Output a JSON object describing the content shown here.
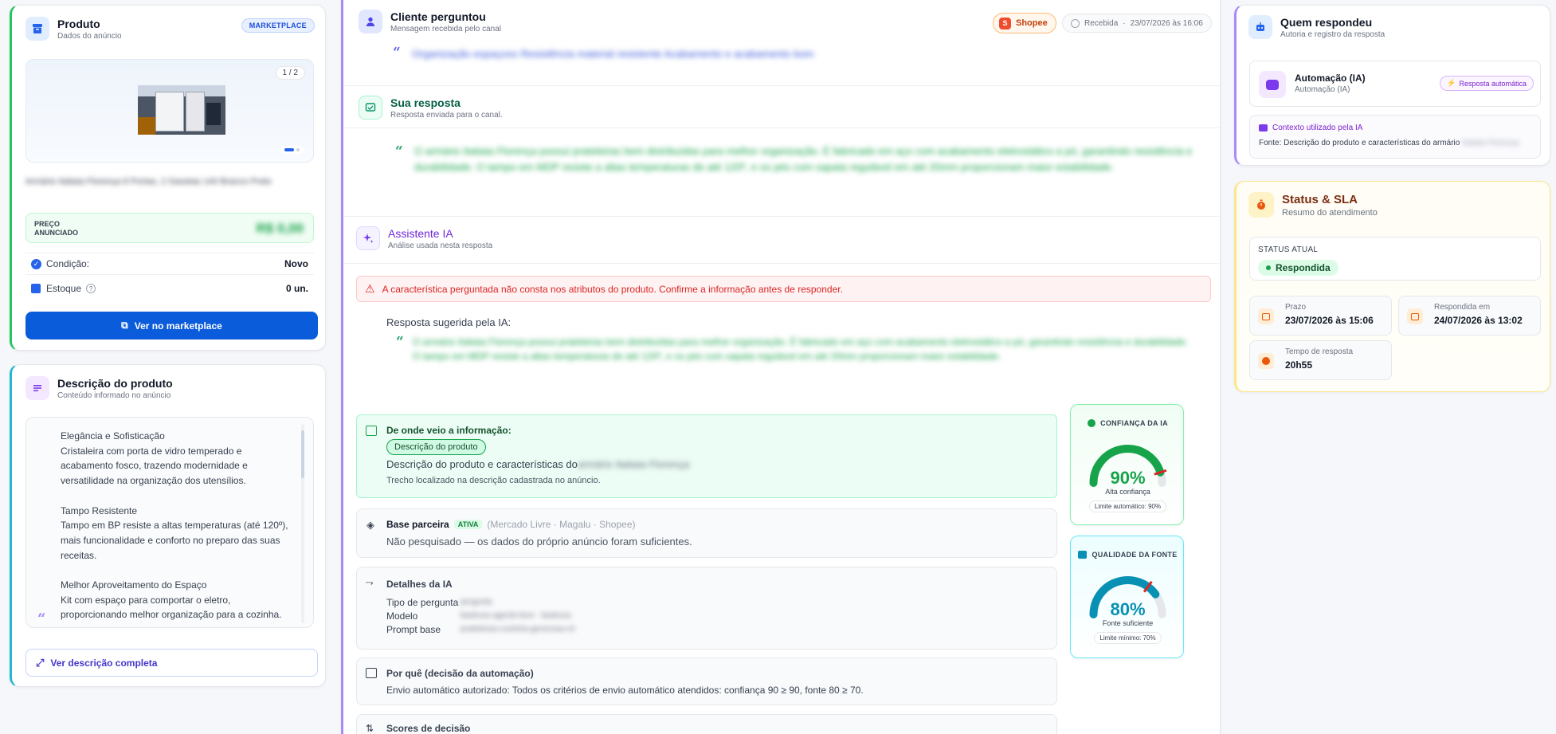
{
  "product": {
    "title": "Produto",
    "subtitle": "Dados do anúncio",
    "badge": "MARKETPLACE",
    "image_counter": "1 / 2",
    "name": "Armário Itatiaia Florença 8 Portas, 2 Gavetas 140 Branco Preto",
    "price_label_1": "PREÇO",
    "price_label_2": "ANUNCIADO",
    "price_value": "R$ 0,00",
    "condition_label": "Condição:",
    "condition_value": "Novo",
    "stock_label": "Estoque",
    "stock_value": "0 un.",
    "view_button": "Ver no marketplace"
  },
  "description": {
    "title": "Descrição do produto",
    "subtitle": "Conteúdo informado no anúncio",
    "lines": [
      "Elegância e Sofisticação",
      "Cristaleira com porta de vidro temperado e",
      "acabamento fosco, trazendo modernidade e",
      "versatilidade na organização dos utensílios.",
      "",
      "Tampo Resistente",
      "Tampo em BP resiste a altas temperaturas (até 120º),",
      "mais funcionalidade e conforto no preparo das suas",
      "receitas.",
      "",
      "Melhor Aproveitamento do Espaço",
      "Kit com espaço para comportar o eletro,",
      "proporcionando melhor organização para a cozinha."
    ],
    "full_link": "Ver descrição completa"
  },
  "question": {
    "title": "Cliente perguntou",
    "subtitle": "Mensagem recebida pelo canal",
    "channel": "Shopee",
    "received_label": "Recebida",
    "received_date": "23/07/2026 às 16:06",
    "text": "Organização espaçoso Resistência material resistente Acabamento e acabamento bom"
  },
  "answer": {
    "title": "Sua resposta",
    "subtitle": "Resposta enviada para o canal.",
    "text": "O armário Itatiaia Florença possui prateleiras bem distribuídas para melhor organização. É fabricado em aço com acabamento eletrostático a pó, garantindo resistência e durabilidade. O tampo em MDP resiste a altas temperaturas de até 120º, e os pés com sapata regulável em até 20mm proporcionam maior estabilidade."
  },
  "assistant": {
    "title": "Assistente IA",
    "subtitle": "Análise usada nesta resposta",
    "warning": "A característica perguntada não consta nos atributos do produto. Confirme a informação antes de responder.",
    "suggested_label": "Resposta sugerida pela IA:",
    "suggested_text": "O armário Itatiaia Florença possui prateleiras bem distribuídas para melhor organização. É fabricado em aço com acabamento eletrostático a pó, garantindo resistência e durabilidade. O tampo em MDP resiste a altas temperaturas de até 120º, e os pés com sapata regulável em até 20mm proporcionam maior estabilidade.",
    "source_title": "De onde veio a informação:",
    "source_chip": "Descrição do produto",
    "source_text": "Descrição do produto e características do",
    "source_text_blur": "armário Itatiaia Florença",
    "source_note": "Trecho localizado na descrição cadastrada no anúncio.",
    "partner_title": "Base parceira",
    "partner_badge": "ATIVA",
    "partner_sources": "(Mercado Livre · Magalu · Shopee)",
    "partner_text": "Não pesquisado — os dados do próprio anúncio foram suficientes.",
    "details_title": "Detalhes da IA",
    "details": [
      {
        "label": "Tipo de pergunta",
        "value": "pergunta"
      },
      {
        "label": "Modelo",
        "value": "baslrusz-agente-livre · baslrusz"
      },
      {
        "label": "Prompt base",
        "value": "prateleiras-cozinha-generosa-v4"
      }
    ],
    "why_title": "Por quê (decisão da automação)",
    "why_text": "Envio automático autorizado: Todos os critérios de envio automático atendidos: confiança 90 ≥ 90, fonte 80 ≥ 70.",
    "scores_title": "Scores de decisão"
  },
  "confidence": {
    "title": "CONFIANÇA DA IA",
    "value": 90,
    "value_text": "90%",
    "caption": "Alta confiança",
    "limit": "Limite automático: 90%",
    "threshold": 90,
    "color": "#16a34a"
  },
  "source_quality": {
    "title": "QUALIDADE DA FONTE",
    "value": 80,
    "value_text": "80%",
    "caption": "Fonte suficiente",
    "limit": "Limite mínimo: 70%",
    "threshold": 70,
    "color": "#0891b2"
  },
  "responder": {
    "title": "Quem respondeu",
    "subtitle": "Autoria e registro da resposta",
    "name": "Automação (IA)",
    "role": "Automação (IA)",
    "badge": "Resposta automática",
    "context_title": "Contexto utilizado pela IA",
    "context_text": "Fonte: Descrição do produto e características do armário",
    "context_blur": "Itatiaia Florença"
  },
  "status": {
    "title": "Status & SLA",
    "subtitle": "Resumo do atendimento",
    "current_label": "STATUS ATUAL",
    "current_value": "Respondida",
    "deadline_label": "Prazo",
    "deadline_value": "23/07/2026 às 15:06",
    "answered_label": "Respondida em",
    "answered_value": "24/07/2026 às 13:02",
    "time_label": "Tempo de resposta",
    "time_value": "20h55"
  }
}
